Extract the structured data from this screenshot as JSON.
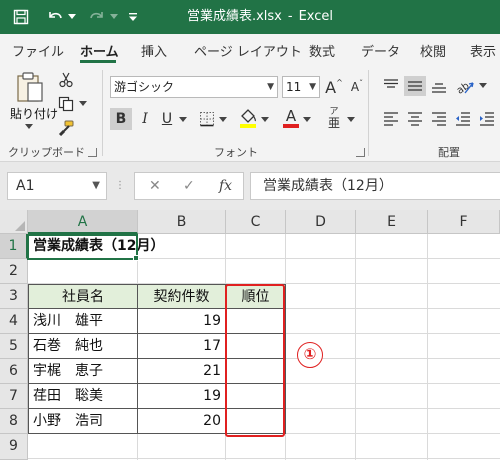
{
  "window": {
    "title": "営業成績表.xlsx",
    "app_name": "Excel",
    "separator": "-",
    "accent_color": "#217346"
  },
  "ribbon": {
    "tabs": [
      {
        "label": "ファイル",
        "active": false
      },
      {
        "label": "ホーム",
        "active": true
      },
      {
        "label": "挿入",
        "active": false
      },
      {
        "label": "ページ レイアウト",
        "active": false
      },
      {
        "label": "数式",
        "active": false
      },
      {
        "label": "データ",
        "active": false
      },
      {
        "label": "校閲",
        "active": false
      },
      {
        "label": "表示",
        "active": false
      }
    ],
    "clipboard": {
      "paste_label": "貼り付け",
      "group_label": "クリップボード"
    },
    "font": {
      "font_name": "游ゴシック",
      "font_size": "11",
      "group_label": "フォント",
      "bold": "B",
      "italic": "I",
      "underline": "U",
      "grow": "A",
      "shrink": "A",
      "color_letter": "A",
      "phonetic": "ア",
      "phonetic_sub": "亜",
      "font_color": "#e02020",
      "fill_color": "#ffff00"
    },
    "alignment": {
      "group_label": "配置"
    }
  },
  "formula_bar": {
    "name_box": "A1",
    "cancel_symbol": "✕",
    "enter_symbol": "✓",
    "fx_symbol": "fx",
    "content": "営業成績表（12月）"
  },
  "grid": {
    "columns": [
      "A",
      "B",
      "C",
      "D",
      "E",
      "F"
    ],
    "rows": [
      "1",
      "2",
      "3",
      "4",
      "5",
      "6",
      "7",
      "8",
      "9"
    ],
    "selected_cell": "A1"
  },
  "sheet": {
    "title_cell": "営業成績表（12月）",
    "headers": {
      "name": "社員名",
      "contracts": "契約件数",
      "rank": "順位"
    },
    "rows": [
      {
        "name": "浅川　雄平",
        "contracts": "19",
        "rank": ""
      },
      {
        "name": "石巻　純也",
        "contracts": "17",
        "rank": ""
      },
      {
        "name": "宇梶　恵子",
        "contracts": "21",
        "rank": ""
      },
      {
        "name": "荏田　聡美",
        "contracts": "19",
        "rank": ""
      },
      {
        "name": "小野　浩司",
        "contracts": "20",
        "rank": ""
      }
    ],
    "header_fill": "#e2efda"
  },
  "annotation": {
    "marker": "①",
    "color": "#e02020"
  }
}
